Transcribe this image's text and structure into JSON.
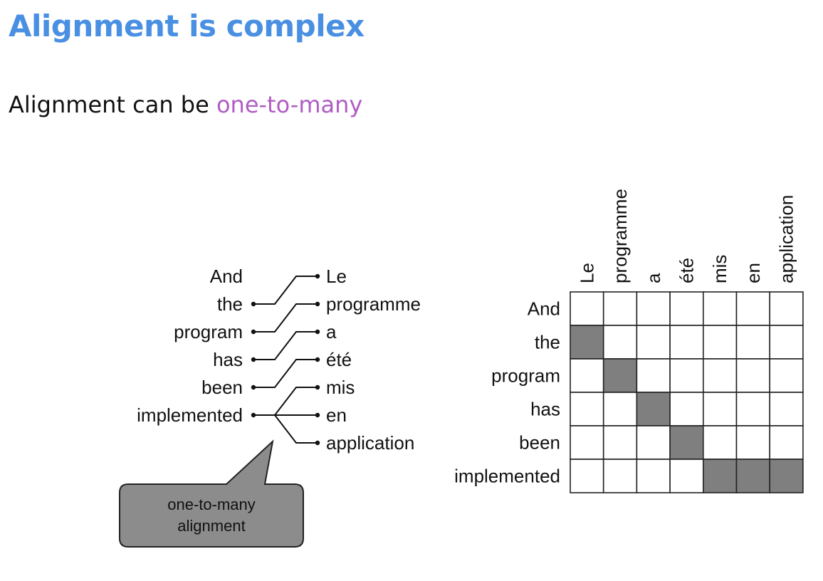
{
  "title": "Alignment is complex",
  "subtitle": {
    "prefix": "Alignment can be ",
    "highlight": "one-to-many",
    "highlight_color": "#b05cc4"
  },
  "accent_color": "#4a90e2",
  "source_words": [
    "And",
    "the",
    "program",
    "has",
    "been",
    "implemented"
  ],
  "target_words": [
    "Le",
    "programme",
    "a",
    "été",
    "mis",
    "en",
    "application"
  ],
  "alignments": [
    [
      1,
      0
    ],
    [
      2,
      1
    ],
    [
      3,
      2
    ],
    [
      4,
      3
    ],
    [
      5,
      4
    ],
    [
      5,
      5
    ],
    [
      5,
      6
    ]
  ],
  "callout": {
    "line1": "one-to-many",
    "line2": "alignment",
    "fill": "#8c8c8c"
  },
  "matrix": {
    "rows": [
      "And",
      "the",
      "program",
      "has",
      "been",
      "implemented"
    ],
    "cols": [
      "Le",
      "programme",
      "a",
      "été",
      "mis",
      "en",
      "application"
    ],
    "filled": [
      [
        1,
        0
      ],
      [
        2,
        1
      ],
      [
        3,
        2
      ],
      [
        4,
        3
      ],
      [
        5,
        4
      ],
      [
        5,
        5
      ],
      [
        5,
        6
      ]
    ],
    "fill_color": "#7f7f7f"
  }
}
